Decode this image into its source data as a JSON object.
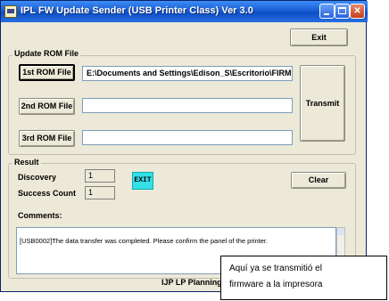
{
  "window": {
    "title": "IPL FW Update Sender (USB Printer Class)  Ver 3.0"
  },
  "buttons": {
    "exit": "Exit",
    "transmit": "Transmit",
    "clear": "Clear",
    "rom1": "1st ROM File",
    "rom2": "2nd ROM File",
    "rom3": "3rd ROM File"
  },
  "update_rom": {
    "group_label": "Update ROM File",
    "rom1_path": "E:\\Documents and Settings\\Edison_S\\Escritorio\\FIRM",
    "rom2_path": "",
    "rom3_path": ""
  },
  "result": {
    "group_label": "Result",
    "discovery_label": "Discovery",
    "discovery_value": "1",
    "success_label": "Success Count",
    "success_value": "1",
    "exit_indicator": "EXIT",
    "comments_label": "Comments:",
    "comments_text": "[USB0002]The data transfer was completed. Please confirm the panel of the printer."
  },
  "footer": {
    "text": "IJP LP Planning"
  },
  "annotation": {
    "line1": "Aquí ya se transmitió  el",
    "line2": "firmware a la impresora"
  }
}
